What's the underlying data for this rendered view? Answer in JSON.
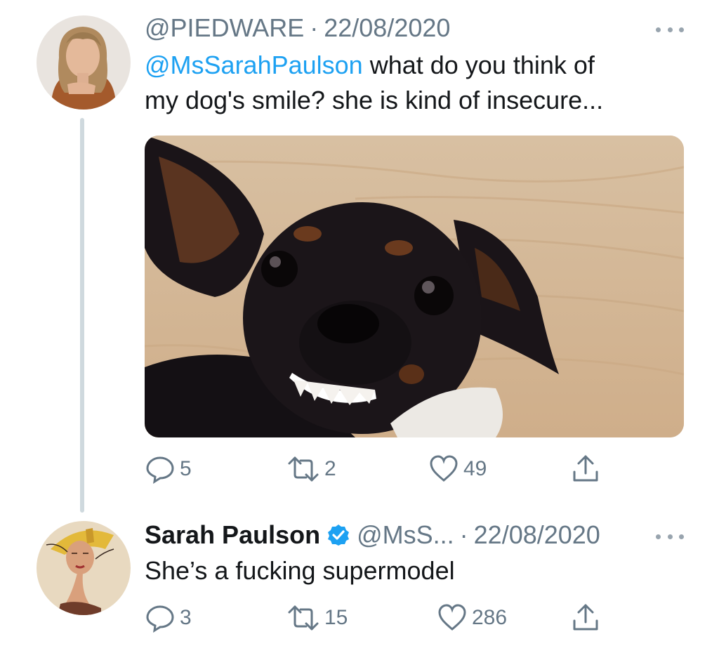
{
  "tweet1": {
    "handle": "@PIEDWARE",
    "separator": "·",
    "date": "22/08/2020",
    "mention": "@MsSarahPaulson",
    "text_line1": " what do you think of",
    "text_line2": "my dog's smile? she is kind of insecure...",
    "media_description": "black-dog-showing-teeth-photo",
    "actions": {
      "replies": "5",
      "retweets": "2",
      "likes": "49"
    }
  },
  "tweet2": {
    "name": "Sarah Paulson",
    "handle": "@MsS...",
    "separator": "·",
    "date": "22/08/2020",
    "text": "She’s a fucking supermodel",
    "actions": {
      "replies": "3",
      "retweets": "15",
      "likes": "286"
    }
  },
  "colors": {
    "link": "#1da1f2",
    "muted": "#657786",
    "verified": "#1da1f2",
    "thread_line": "#cfd9de"
  }
}
